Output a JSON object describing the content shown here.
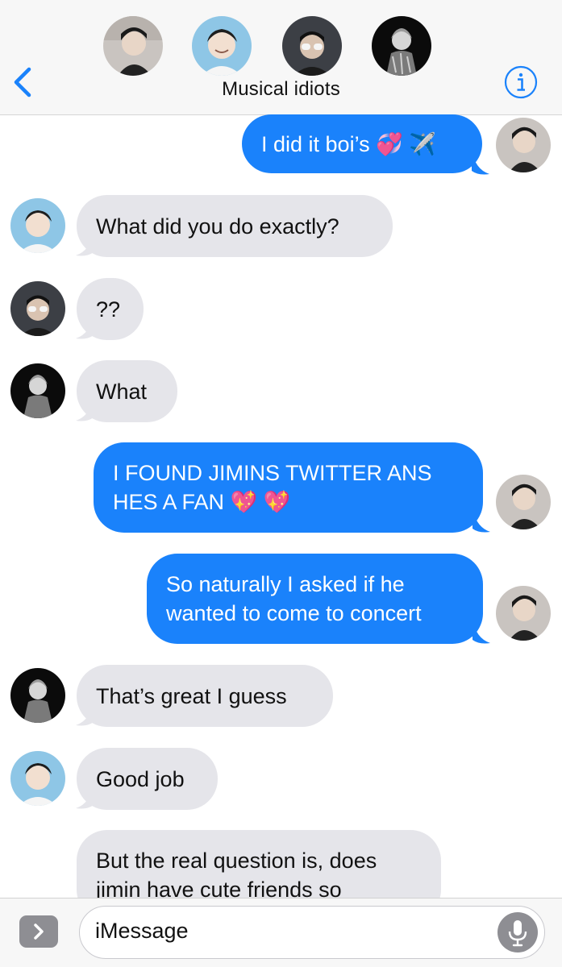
{
  "header": {
    "title": "Musical idiots",
    "back_icon": "chevron-left-icon",
    "info_icon": "info-icon",
    "accent": "#1a82fb",
    "participants": [
      "avatar-1",
      "avatar-2",
      "avatar-3",
      "avatar-4"
    ]
  },
  "messages": [
    {
      "dir": "out",
      "text": "I did it boi’s 💞 ✈️"
    },
    {
      "dir": "in",
      "text": "What did you do exactly?"
    },
    {
      "dir": "in",
      "text": "??"
    },
    {
      "dir": "in",
      "text": "What"
    },
    {
      "dir": "out",
      "line1": "I FOUND JIMINS TWITTER ANS",
      "line2": "HES A FAN 💖 💖"
    },
    {
      "dir": "out",
      "line1": "So naturally I asked if he",
      "line2": "wanted to come to concert"
    },
    {
      "dir": "in",
      "text": "That’s great I guess"
    },
    {
      "dir": "in",
      "text": "Good job"
    },
    {
      "dir": "in",
      "line1": "But the real question is, does",
      "line2": "jimin have cute friends so"
    }
  ],
  "input": {
    "placeholder": "iMessage",
    "apps_icon": "chevron-right-icon",
    "mic_icon": "microphone-icon"
  },
  "colors": {
    "incoming_bubble": "#e5e5ea",
    "outgoing_bubble": "#1a82fb",
    "header_bg": "#f7f7f7"
  }
}
